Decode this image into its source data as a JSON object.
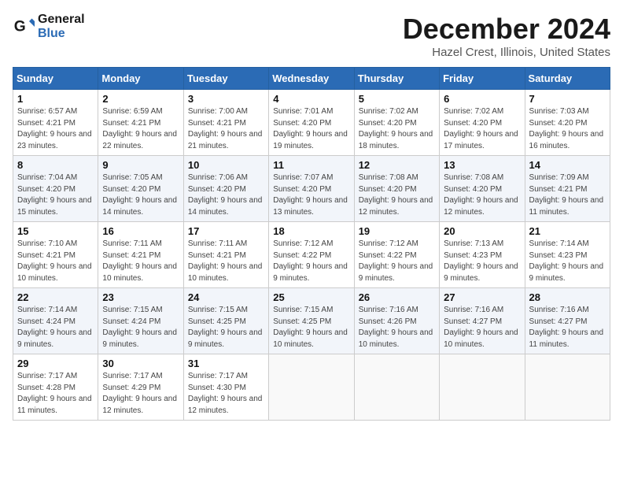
{
  "header": {
    "logo_line1": "General",
    "logo_line2": "Blue",
    "month_title": "December 2024",
    "location": "Hazel Crest, Illinois, United States"
  },
  "weekdays": [
    "Sunday",
    "Monday",
    "Tuesday",
    "Wednesday",
    "Thursday",
    "Friday",
    "Saturday"
  ],
  "weeks": [
    [
      {
        "day": "1",
        "sunrise": "6:57 AM",
        "sunset": "4:21 PM",
        "daylight": "9 hours and 23 minutes."
      },
      {
        "day": "2",
        "sunrise": "6:59 AM",
        "sunset": "4:21 PM",
        "daylight": "9 hours and 22 minutes."
      },
      {
        "day": "3",
        "sunrise": "7:00 AM",
        "sunset": "4:21 PM",
        "daylight": "9 hours and 21 minutes."
      },
      {
        "day": "4",
        "sunrise": "7:01 AM",
        "sunset": "4:20 PM",
        "daylight": "9 hours and 19 minutes."
      },
      {
        "day": "5",
        "sunrise": "7:02 AM",
        "sunset": "4:20 PM",
        "daylight": "9 hours and 18 minutes."
      },
      {
        "day": "6",
        "sunrise": "7:02 AM",
        "sunset": "4:20 PM",
        "daylight": "9 hours and 17 minutes."
      },
      {
        "day": "7",
        "sunrise": "7:03 AM",
        "sunset": "4:20 PM",
        "daylight": "9 hours and 16 minutes."
      }
    ],
    [
      {
        "day": "8",
        "sunrise": "7:04 AM",
        "sunset": "4:20 PM",
        "daylight": "9 hours and 15 minutes."
      },
      {
        "day": "9",
        "sunrise": "7:05 AM",
        "sunset": "4:20 PM",
        "daylight": "9 hours and 14 minutes."
      },
      {
        "day": "10",
        "sunrise": "7:06 AM",
        "sunset": "4:20 PM",
        "daylight": "9 hours and 14 minutes."
      },
      {
        "day": "11",
        "sunrise": "7:07 AM",
        "sunset": "4:20 PM",
        "daylight": "9 hours and 13 minutes."
      },
      {
        "day": "12",
        "sunrise": "7:08 AM",
        "sunset": "4:20 PM",
        "daylight": "9 hours and 12 minutes."
      },
      {
        "day": "13",
        "sunrise": "7:08 AM",
        "sunset": "4:20 PM",
        "daylight": "9 hours and 12 minutes."
      },
      {
        "day": "14",
        "sunrise": "7:09 AM",
        "sunset": "4:21 PM",
        "daylight": "9 hours and 11 minutes."
      }
    ],
    [
      {
        "day": "15",
        "sunrise": "7:10 AM",
        "sunset": "4:21 PM",
        "daylight": "9 hours and 10 minutes."
      },
      {
        "day": "16",
        "sunrise": "7:11 AM",
        "sunset": "4:21 PM",
        "daylight": "9 hours and 10 minutes."
      },
      {
        "day": "17",
        "sunrise": "7:11 AM",
        "sunset": "4:21 PM",
        "daylight": "9 hours and 10 minutes."
      },
      {
        "day": "18",
        "sunrise": "7:12 AM",
        "sunset": "4:22 PM",
        "daylight": "9 hours and 9 minutes."
      },
      {
        "day": "19",
        "sunrise": "7:12 AM",
        "sunset": "4:22 PM",
        "daylight": "9 hours and 9 minutes."
      },
      {
        "day": "20",
        "sunrise": "7:13 AM",
        "sunset": "4:23 PM",
        "daylight": "9 hours and 9 minutes."
      },
      {
        "day": "21",
        "sunrise": "7:14 AM",
        "sunset": "4:23 PM",
        "daylight": "9 hours and 9 minutes."
      }
    ],
    [
      {
        "day": "22",
        "sunrise": "7:14 AM",
        "sunset": "4:24 PM",
        "daylight": "9 hours and 9 minutes."
      },
      {
        "day": "23",
        "sunrise": "7:15 AM",
        "sunset": "4:24 PM",
        "daylight": "9 hours and 9 minutes."
      },
      {
        "day": "24",
        "sunrise": "7:15 AM",
        "sunset": "4:25 PM",
        "daylight": "9 hours and 9 minutes."
      },
      {
        "day": "25",
        "sunrise": "7:15 AM",
        "sunset": "4:25 PM",
        "daylight": "9 hours and 10 minutes."
      },
      {
        "day": "26",
        "sunrise": "7:16 AM",
        "sunset": "4:26 PM",
        "daylight": "9 hours and 10 minutes."
      },
      {
        "day": "27",
        "sunrise": "7:16 AM",
        "sunset": "4:27 PM",
        "daylight": "9 hours and 10 minutes."
      },
      {
        "day": "28",
        "sunrise": "7:16 AM",
        "sunset": "4:27 PM",
        "daylight": "9 hours and 11 minutes."
      }
    ],
    [
      {
        "day": "29",
        "sunrise": "7:17 AM",
        "sunset": "4:28 PM",
        "daylight": "9 hours and 11 minutes."
      },
      {
        "day": "30",
        "sunrise": "7:17 AM",
        "sunset": "4:29 PM",
        "daylight": "9 hours and 12 minutes."
      },
      {
        "day": "31",
        "sunrise": "7:17 AM",
        "sunset": "4:30 PM",
        "daylight": "9 hours and 12 minutes."
      },
      null,
      null,
      null,
      null
    ]
  ]
}
